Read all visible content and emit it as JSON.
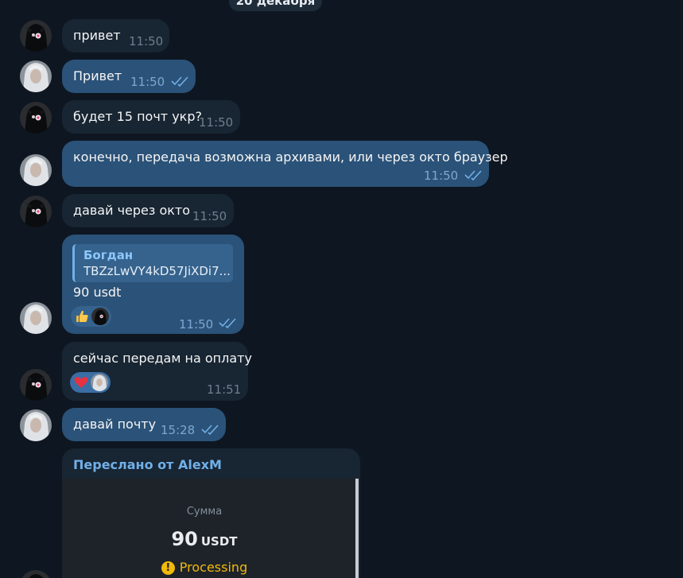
{
  "date_separator": "20 декабря",
  "messages": [
    {
      "id": "m1",
      "direction": "in",
      "text": "привет",
      "time": "11:50"
    },
    {
      "id": "m2",
      "direction": "out",
      "text": "Привет",
      "time": "11:50",
      "read": true
    },
    {
      "id": "m3",
      "direction": "in",
      "text": "будет 15 почт укр?",
      "time": "11:50"
    },
    {
      "id": "m4",
      "direction": "out",
      "text": "конечно, передача возможна архивами, или через окто браузер",
      "time": "11:50",
      "read": true
    },
    {
      "id": "m5",
      "direction": "in",
      "text": "давай через окто",
      "time": "11:50"
    },
    {
      "id": "m6",
      "direction": "out",
      "text": "90 usdt",
      "time": "11:50",
      "read": true,
      "reply": {
        "author": "Богдан",
        "text": "TBZzLwVY4kD57JiXDi7..."
      },
      "reaction": {
        "emoji": "thumbs-up",
        "from": "peer"
      }
    },
    {
      "id": "m7",
      "direction": "in",
      "text": "сейчас передам на оплату",
      "time": "11:51",
      "reaction": {
        "emoji": "heart",
        "from": "me"
      }
    },
    {
      "id": "m8",
      "direction": "out",
      "text": "давай почту",
      "time": "15:28",
      "read": true
    }
  ],
  "forwarded": {
    "header": "Переслано от AlexM",
    "amount_label": "Сумма",
    "amount": "90",
    "currency": "USDT",
    "status": "Processing",
    "status_icon": "!"
  },
  "colors": {
    "background": "#0e1621",
    "incoming_bubble": "#182533",
    "outgoing_bubble": "#2b5278",
    "accent": "#71b0e8",
    "status_processing": "#f0b90b"
  }
}
